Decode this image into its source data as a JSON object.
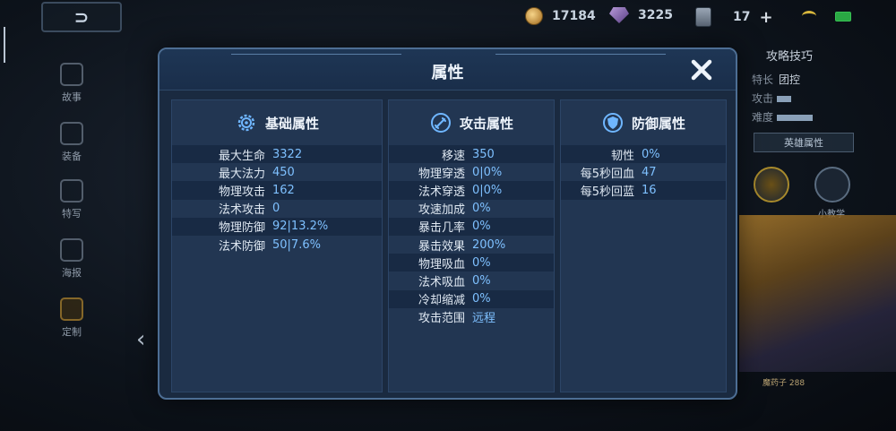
{
  "topbar": {
    "back_label": "⊃",
    "resources": [
      {
        "icon": "coin-icon",
        "value": "17184"
      },
      {
        "icon": "gem-icon",
        "value": "3225"
      },
      {
        "icon": "card-icon",
        "value": "17"
      }
    ],
    "plus": "+"
  },
  "left_nav": [
    {
      "label": "故事"
    },
    {
      "label": "装备"
    },
    {
      "label": "特写"
    },
    {
      "label": "海报"
    },
    {
      "label": "定制"
    }
  ],
  "right_panel": {
    "title": "攻略技巧",
    "specialty_label": "特长",
    "specialty_value": "团控",
    "attack_label": "攻击",
    "difficulty_label": "难度",
    "hero_attr_button": "英雄属性",
    "tutorial_label": "小教学",
    "caption": "魔药子 288"
  },
  "modal": {
    "title": "属性",
    "columns": [
      {
        "title": "基础属性",
        "icon": "gear-icon",
        "rows": [
          {
            "k": "最大生命",
            "v": "3322"
          },
          {
            "k": "最大法力",
            "v": "450"
          },
          {
            "k": "物理攻击",
            "v": "162"
          },
          {
            "k": "法术攻击",
            "v": "0"
          },
          {
            "k": "物理防御",
            "v": "92|13.2%"
          },
          {
            "k": "法术防御",
            "v": "50|7.6%"
          }
        ]
      },
      {
        "title": "攻击属性",
        "icon": "sword-icon",
        "rows": [
          {
            "k": "移速",
            "v": "350"
          },
          {
            "k": "物理穿透",
            "v": "0|0%"
          },
          {
            "k": "法术穿透",
            "v": "0|0%"
          },
          {
            "k": "攻速加成",
            "v": "0%"
          },
          {
            "k": "暴击几率",
            "v": "0%"
          },
          {
            "k": "暴击效果",
            "v": "200%"
          },
          {
            "k": "物理吸血",
            "v": "0%"
          },
          {
            "k": "法术吸血",
            "v": "0%"
          },
          {
            "k": "冷却缩减",
            "v": "0%"
          },
          {
            "k": "攻击范围",
            "v": "远程"
          }
        ]
      },
      {
        "title": "防御属性",
        "icon": "shield-icon",
        "rows": [
          {
            "k": "韧性",
            "v": "0%"
          },
          {
            "k": "每5秒回血",
            "v": "47"
          },
          {
            "k": "每5秒回蓝",
            "v": "16"
          }
        ]
      }
    ]
  },
  "colors": {
    "accent": "#7ec0ff",
    "panel": "#223652",
    "border": "#4d6e94"
  }
}
